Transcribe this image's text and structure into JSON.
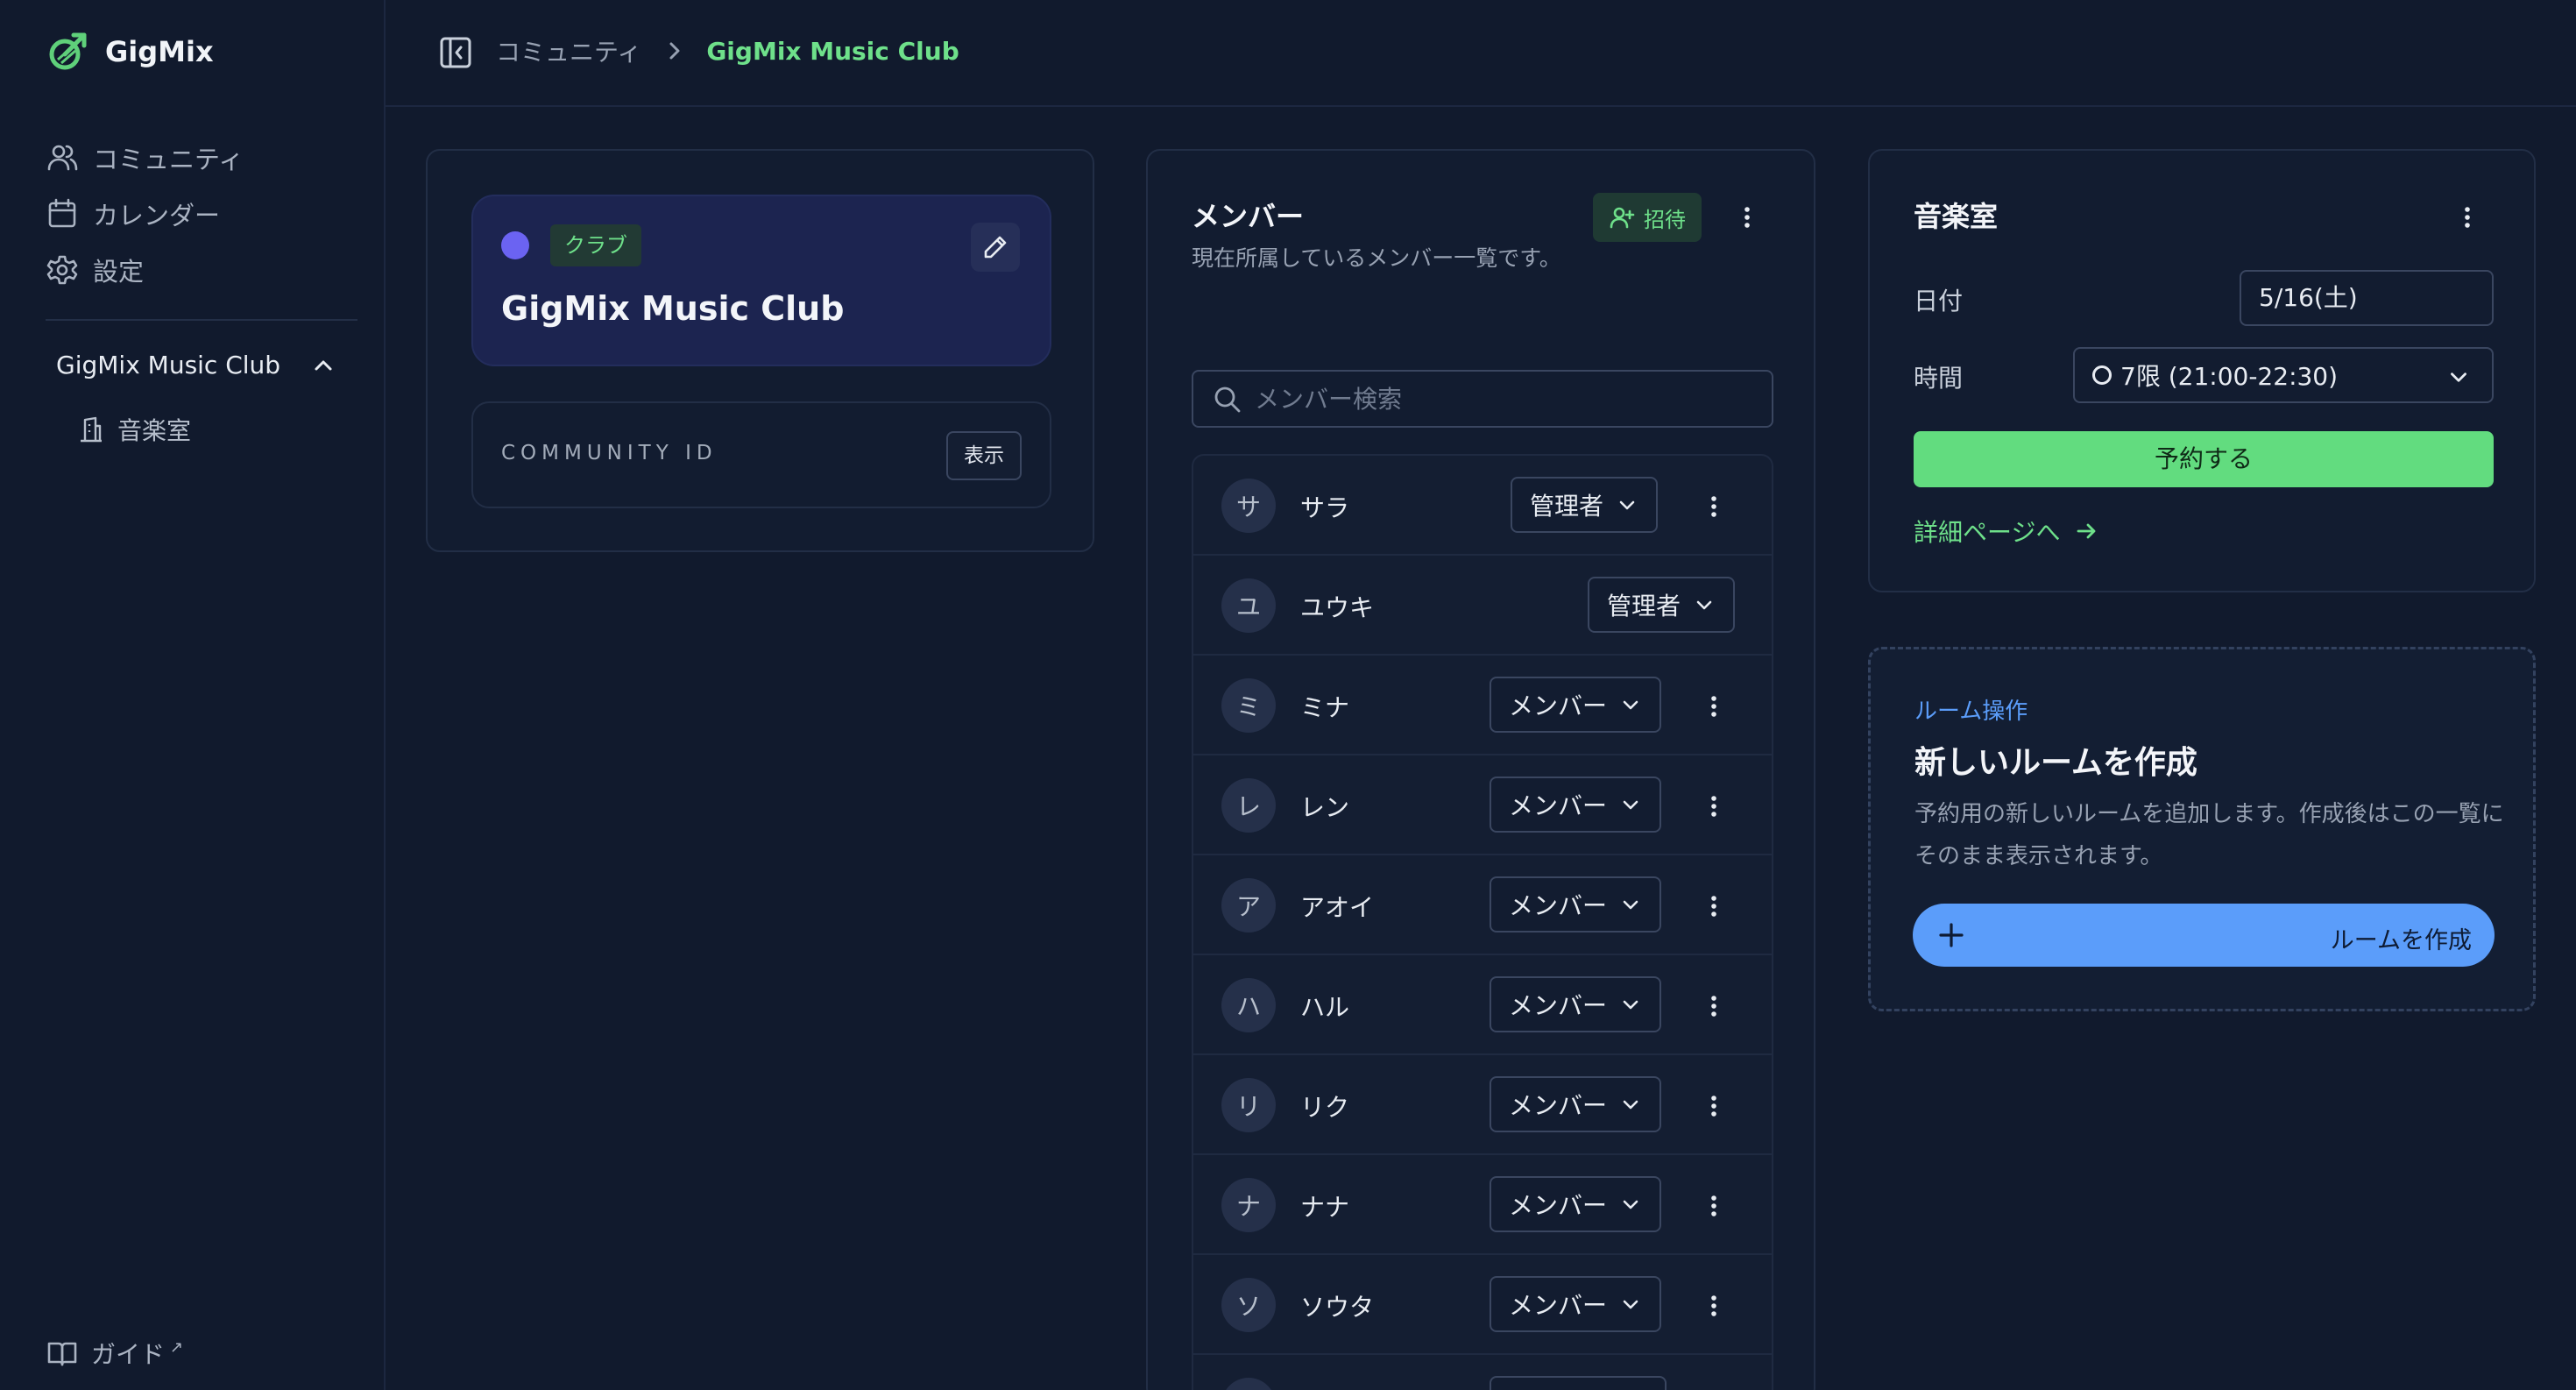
{
  "app": {
    "name": "GigMix"
  },
  "sidebar": {
    "nav": [
      {
        "label": "コミュニティ",
        "icon": "users-icon"
      },
      {
        "label": "カレンダー",
        "icon": "calendar-icon"
      },
      {
        "label": "設定",
        "icon": "gear-icon"
      }
    ],
    "club": {
      "name": "GigMix Music Club",
      "expanded": true
    },
    "sub_items": [
      {
        "label": "音楽室",
        "icon": "building-icon"
      }
    ],
    "guide_label": "ガイド",
    "guide_ext": "↗"
  },
  "header": {
    "breadcrumb": [
      "コミュニティ",
      "GigMix Music Club"
    ]
  },
  "club_card": {
    "tag": "クラブ",
    "name": "GigMix Music Club",
    "dot_color": "#6b63f2",
    "community_id_label": "COMMUNITY ID",
    "show_label": "表示"
  },
  "members": {
    "title": "メンバー",
    "description": "現在所属しているメンバー一覧です。",
    "invite_label": "招待",
    "search_placeholder": "メンバー検索",
    "rows": [
      {
        "initial": "サ",
        "name": "サラ",
        "role": "管理者",
        "has_menu": true
      },
      {
        "initial": "ユ",
        "name": "ユウキ",
        "role": "管理者",
        "has_menu": false
      },
      {
        "initial": "ミ",
        "name": "ミナ",
        "role": "メンバー",
        "has_menu": true
      },
      {
        "initial": "レ",
        "name": "レン",
        "role": "メンバー",
        "has_menu": true
      },
      {
        "initial": "ア",
        "name": "アオイ",
        "role": "メンバー",
        "has_menu": true
      },
      {
        "initial": "ハ",
        "name": "ハル",
        "role": "メンバー",
        "has_menu": true
      },
      {
        "initial": "リ",
        "name": "リク",
        "role": "メンバー",
        "has_menu": true
      },
      {
        "initial": "ナ",
        "name": "ナナ",
        "role": "メンバー",
        "has_menu": true
      },
      {
        "initial": "ソ",
        "name": "ソウタ",
        "role": "メンバー",
        "has_menu": true
      }
    ]
  },
  "room": {
    "title": "音楽室",
    "date_label": "日付",
    "date_value": "5/16(土)",
    "time_label": "時間",
    "time_value": "7限 (21:00-22:30)",
    "reserve_label": "予約する",
    "detail_link": "詳細ページへ"
  },
  "room_ops": {
    "label": "ルーム操作",
    "title": "新しいルームを作成",
    "description": "予約用の新しいルームを追加します。作成後はこの一覧にそのまま表示されます。",
    "create_label": "ルームを作成"
  },
  "colors": {
    "accent_green": "#6ee08a",
    "accent_blue": "#5b9dfa",
    "club_dot": "#6b63f2"
  }
}
